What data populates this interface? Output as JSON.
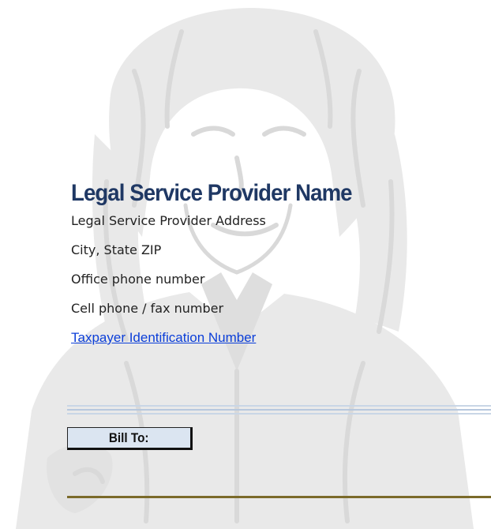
{
  "provider": {
    "name": "Legal Service Provider Name",
    "address": "Legal Service Provider Address",
    "city_state_zip": "City, State ZIP",
    "office_phone": "Office phone number",
    "cell_fax": "Cell phone / fax number",
    "tax_id_link": "Taxpayer Identification Number"
  },
  "bill_to": {
    "label": "Bill To:"
  },
  "colors": {
    "title": "#1f3864",
    "link": "#0b3ed8",
    "billto_fill": "#dbe5f1",
    "gold_rule": "#7b6a2a",
    "blue_rule": "#c9d6e6"
  },
  "icons": {
    "watermark": "lawyer-portrait-watermark"
  }
}
